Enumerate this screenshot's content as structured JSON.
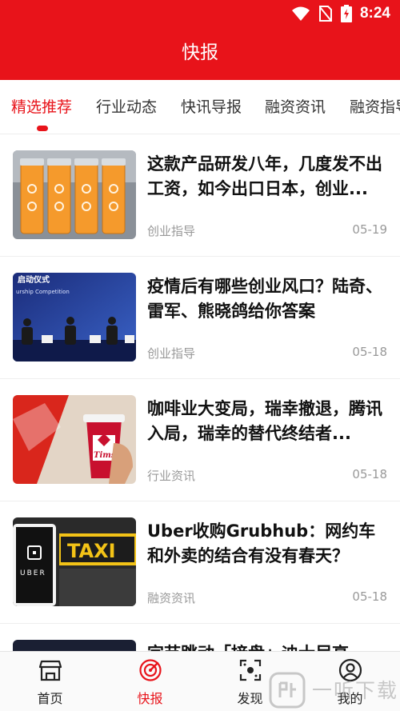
{
  "status_bar": {
    "time": "8:24"
  },
  "header": {
    "title": "快报"
  },
  "tabs": [
    {
      "label": "精选推荐",
      "active": true
    },
    {
      "label": "行业动态",
      "active": false
    },
    {
      "label": "快讯导报",
      "active": false
    },
    {
      "label": "融资资讯",
      "active": false
    },
    {
      "label": "融资指导",
      "active": false
    }
  ],
  "news": [
    {
      "title": "这款产品研发八年，几度发不出工资，如今出口日本，创业...",
      "category": "创业指导",
      "date": "05-19"
    },
    {
      "title": "疫情后有哪些创业风口？陆奇、雷军、熊晓鸽给你答案",
      "category": "创业指导",
      "date": "05-18",
      "image_text": "启动仪式",
      "image_subtext": "urship Competition"
    },
    {
      "title": "咖啡业大变局，瑞幸撤退，腾讯入局，瑞幸的替代终结者...",
      "category": "行业资讯",
      "date": "05-18",
      "image_text": "Tims"
    },
    {
      "title": "Uber收购Grubhub：网约车和外卖的结合有没有春天？",
      "category": "融资资讯",
      "date": "05-18",
      "image_text": "TAXI",
      "image_subtext": "UBER"
    },
    {
      "title": "字节跳动「接盘」迪士尼高..."
    }
  ],
  "bottom_nav": [
    {
      "label": "首页",
      "icon": "home-icon",
      "active": false
    },
    {
      "label": "快报",
      "icon": "bulletin-icon",
      "active": true
    },
    {
      "label": "发现",
      "icon": "discover-icon",
      "active": false
    },
    {
      "label": "我的",
      "icon": "profile-icon",
      "active": false
    }
  ],
  "watermark": {
    "text": "一听下载"
  },
  "colors": {
    "brand_red": "#e8131a",
    "meta_gray": "#999999",
    "title_text": "#111111"
  }
}
